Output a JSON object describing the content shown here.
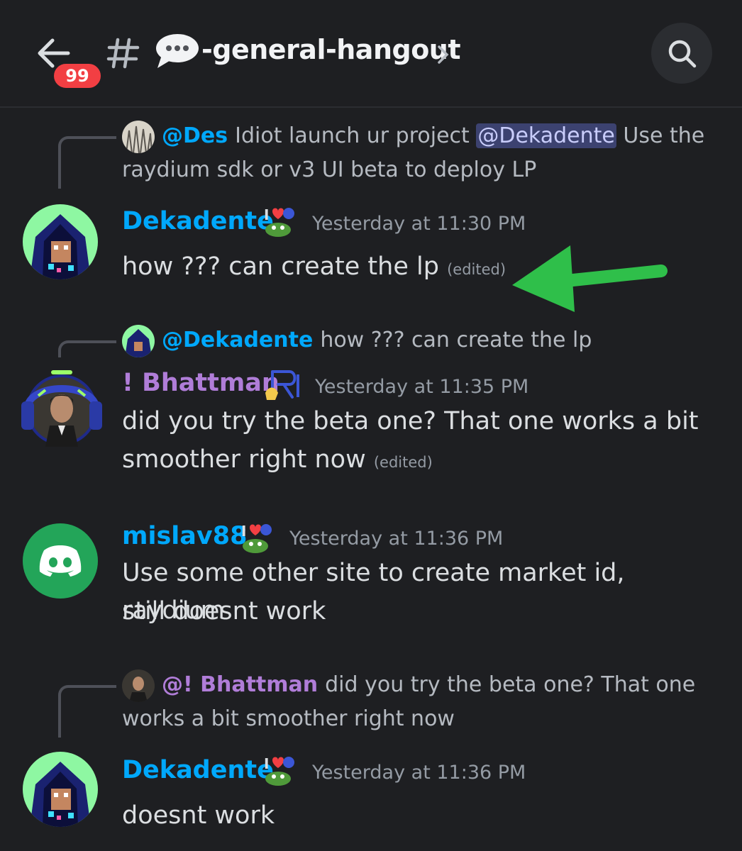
{
  "header": {
    "unread_count": "99",
    "channel_name": "-general-hangout",
    "icons": [
      "back-arrow-icon",
      "hash-icon",
      "speech-bubble-icon",
      "chevron-right-icon",
      "search-icon"
    ]
  },
  "messages": [
    {
      "reply": {
        "author": "@Des",
        "text_before": "Idiot launch ur project",
        "mention": "@Dekadente",
        "text_after": "Use the",
        "text_line2": "raydium sdk or v3 UI beta to deploy LP"
      },
      "author": "Dekadente",
      "timestamp": "Yesterday at 11:30 PM",
      "content": "how ??? can create the lp",
      "edited": "(edited)"
    },
    {
      "reply": {
        "author": "@Dekadente",
        "text": "how ??? can create the lp"
      },
      "author": "! Bhattman",
      "timestamp": "Yesterday at 11:35 PM",
      "content_line1": "did you try the beta one? That one works a bit",
      "content_line2": "smoother right now",
      "edited": "(edited)"
    },
    {
      "author": "mislav88",
      "timestamp": "Yesterday at 11:36 PM",
      "content_line1": "Use some other site to create market id, raydium",
      "content_line2": "still doesnt work"
    },
    {
      "reply": {
        "author": "@! Bhattman",
        "text": "did you try the beta one? That one",
        "text_line2": "works a bit smoother right now"
      },
      "author": "Dekadente",
      "timestamp": "Yesterday at 11:36 PM",
      "content": "doesnt work"
    }
  ],
  "colors": {
    "background": "#1e1f22",
    "username_blue": "#00a8fc",
    "username_purple": "#b07dd8",
    "annotation_arrow": "#2fbf4a",
    "badge_red": "#f23f43"
  }
}
